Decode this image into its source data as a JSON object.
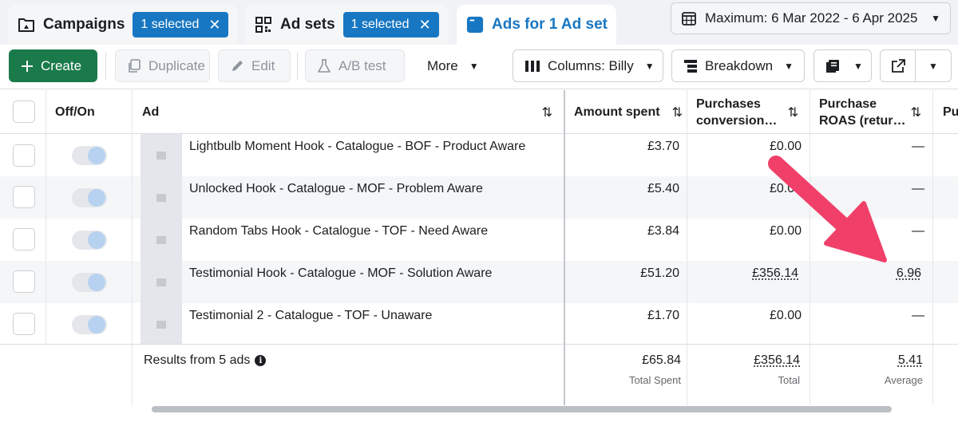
{
  "tabs": {
    "campaigns": {
      "label": "Campaigns",
      "selected": "1 selected"
    },
    "adsets": {
      "label": "Ad sets",
      "selected": "1 selected"
    },
    "ads": {
      "label": "Ads for 1 Ad set"
    }
  },
  "date_range": "Maximum: 6 Mar 2022 - 6 Apr 2025",
  "toolbar": {
    "create": "Create",
    "duplicate": "Duplicate",
    "edit": "Edit",
    "ab_test": "A/B test",
    "more": "More",
    "columns": "Columns: Billy",
    "breakdown": "Breakdown"
  },
  "columns": {
    "offon": "Off/On",
    "ad": "Ad",
    "amount_spent": "Amount spent",
    "purchases_conv_l1": "Purchases",
    "purchases_conv_l2": "conversion…",
    "roas_l1": "Purchase",
    "roas_l2": "ROAS (retur…",
    "next": "Pu"
  },
  "rows": [
    {
      "name": "Lightbulb Moment Hook - Catalogue - BOF - Product Aware",
      "spent": "£3.70",
      "conv": "£0.00",
      "roas": "—"
    },
    {
      "name": "Unlocked Hook - Catalogue - MOF - Problem Aware",
      "spent": "£5.40",
      "conv": "£0.00",
      "roas": "—"
    },
    {
      "name": "Random Tabs Hook - Catalogue - TOF - Need Aware",
      "spent": "£3.84",
      "conv": "£0.00",
      "roas": "—"
    },
    {
      "name": "Testimonial Hook - Catalogue - MOF - Solution Aware",
      "spent": "£51.20",
      "conv": "£356.14",
      "roas": "6.96"
    },
    {
      "name": "Testimonial 2 - Catalogue - TOF - Unaware",
      "spent": "£1.70",
      "conv": "£0.00",
      "roas": "—"
    }
  ],
  "footer": {
    "results": "Results from 5 ads",
    "spent": "£65.84",
    "spent_label": "Total Spent",
    "conv": "£356.14",
    "conv_label": "Total",
    "roas": "5.41",
    "roas_label": "Average"
  },
  "colors": {
    "brand_blue": "#1877c2",
    "create_green": "#1a7a4a",
    "annotation_arrow": "#f0406a"
  }
}
